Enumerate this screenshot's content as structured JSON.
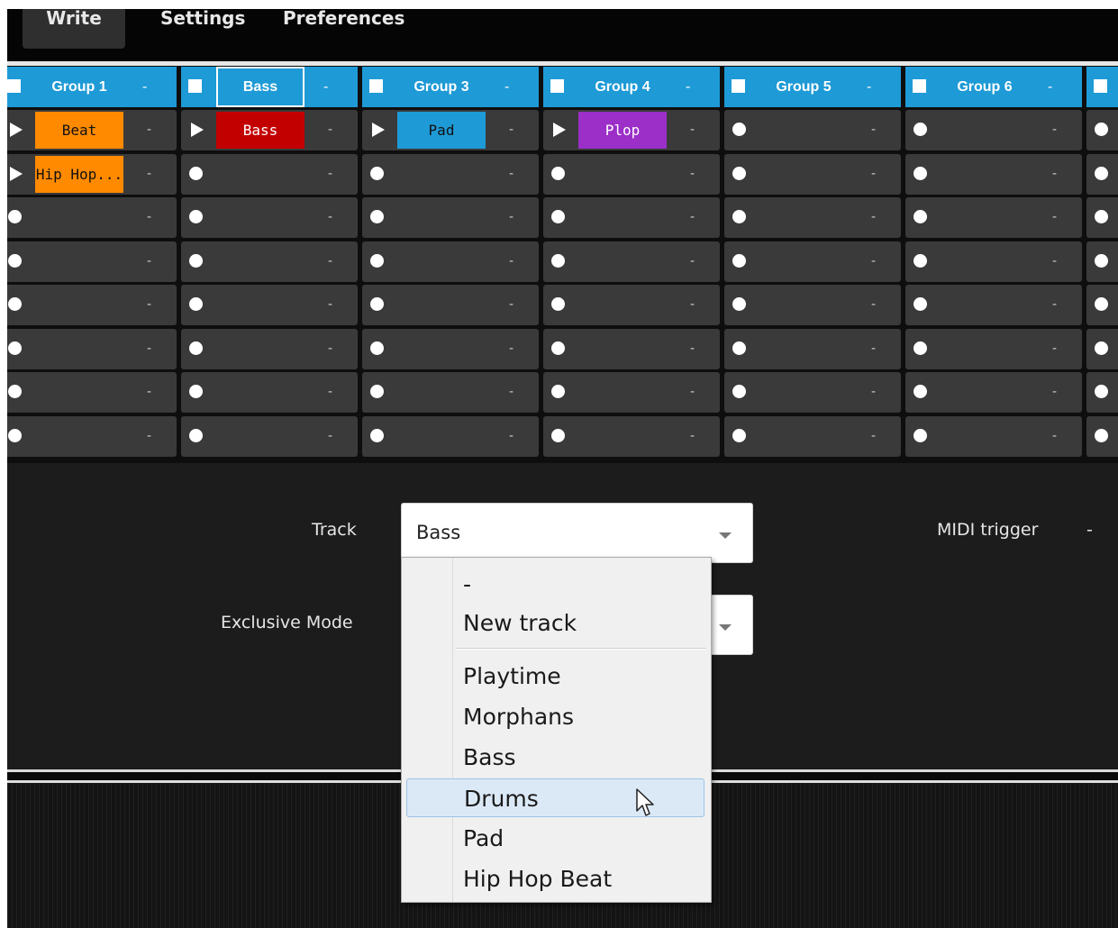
{
  "menu": {
    "write": "Write",
    "settings": "Settings",
    "preferences": "Preferences"
  },
  "groups": [
    {
      "name": "Group 1",
      "dash": "-",
      "selected": false
    },
    {
      "name": "Bass",
      "dash": "-",
      "selected": true
    },
    {
      "name": "Group 3",
      "dash": "-",
      "selected": false
    },
    {
      "name": "Group 4",
      "dash": "-",
      "selected": false
    },
    {
      "name": "Group 5",
      "dash": "-",
      "selected": false
    },
    {
      "name": "Group 6",
      "dash": "-",
      "selected": false
    },
    {
      "name": "",
      "dash": "",
      "selected": false
    }
  ],
  "clips": [
    {
      "col": 0,
      "row": 0,
      "label": "Beat",
      "color": "#ff8a00",
      "light": false
    },
    {
      "col": 0,
      "row": 1,
      "label": "Hip Hop...",
      "color": "#ff8a00",
      "light": false
    },
    {
      "col": 1,
      "row": 0,
      "label": "Bass",
      "color": "#c30000",
      "light": true
    },
    {
      "col": 2,
      "row": 0,
      "label": "Pad",
      "color": "#1e9ad6",
      "light": false
    },
    {
      "col": 3,
      "row": 0,
      "label": "Plop",
      "color": "#9b2fc8",
      "light": true
    }
  ],
  "slot_dash": "-",
  "panel": {
    "track_label": "Track",
    "track_value": "Bass",
    "exclusive_label": "Exclusive Mode",
    "midi_label": "MIDI trigger",
    "midi_value": "-"
  },
  "dropdown": {
    "options_top": [
      "-",
      "New track"
    ],
    "options": [
      "Playtime",
      "Morphans",
      "Bass",
      "Drums",
      "Pad",
      "Hip Hop Beat"
    ],
    "hovered": "Drums"
  }
}
